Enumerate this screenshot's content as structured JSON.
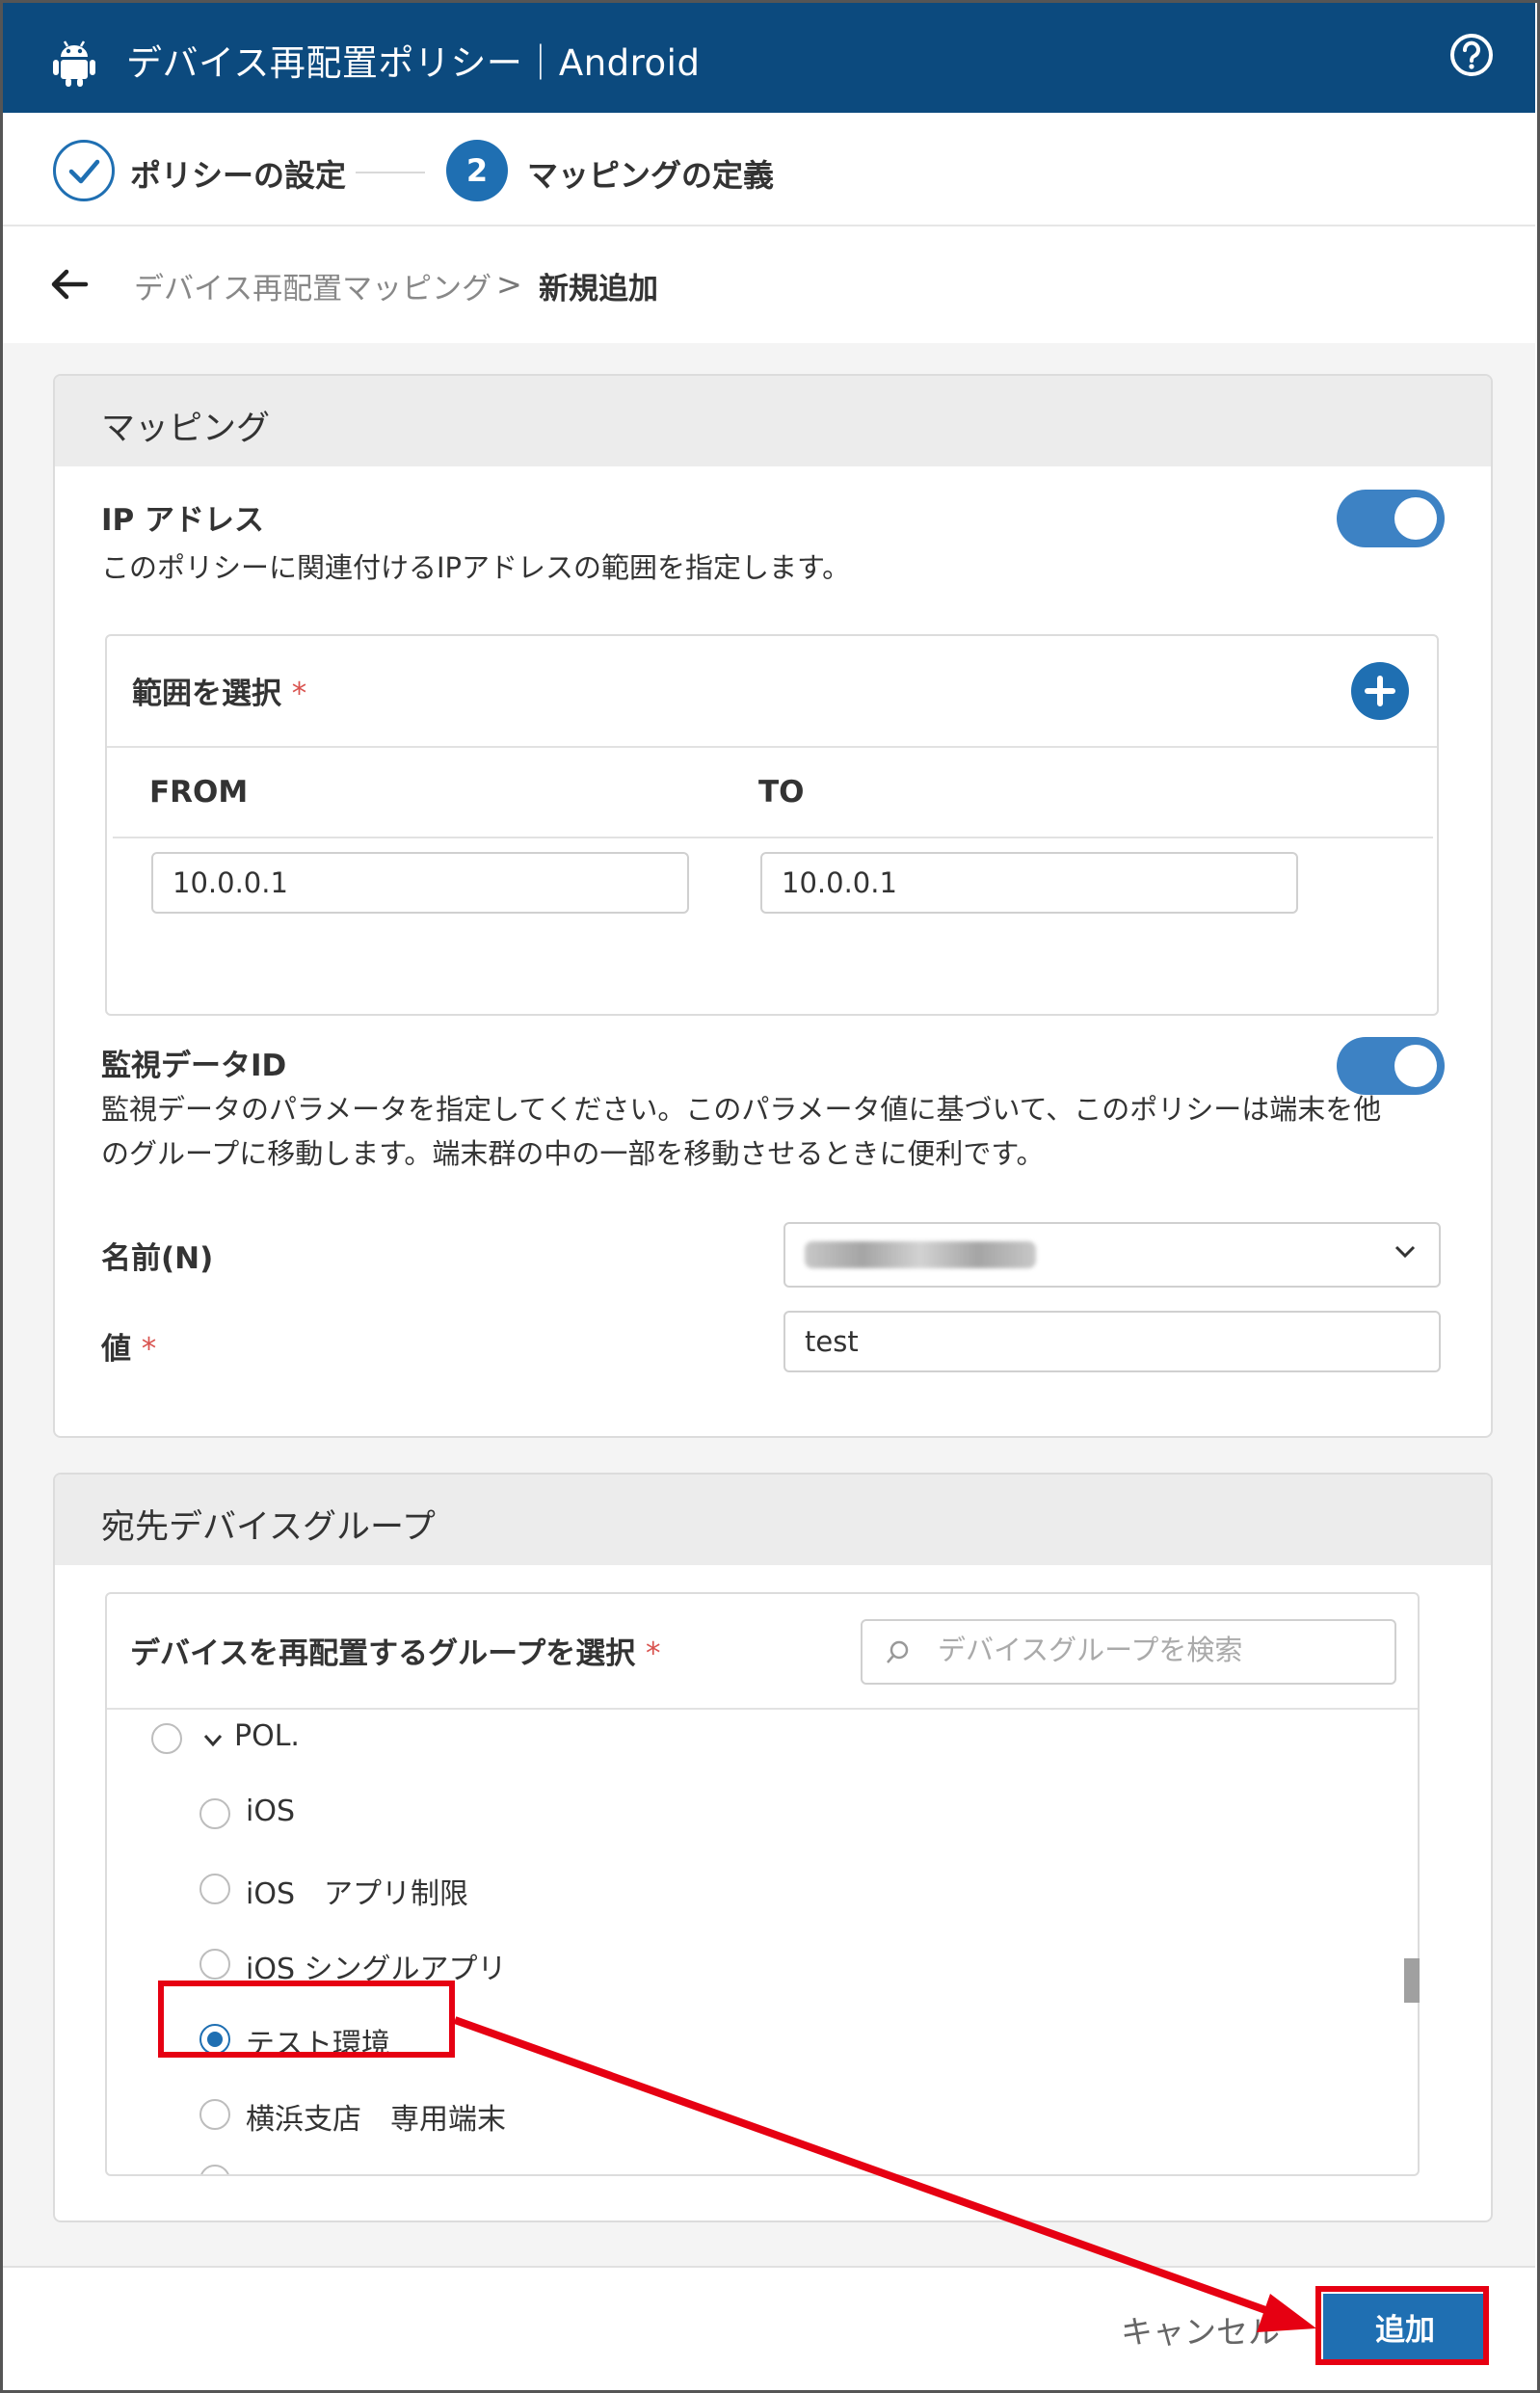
{
  "header": {
    "title": "デバイス再配置ポリシー｜Android",
    "logo_icon": "android-icon",
    "help_icon": "help-icon"
  },
  "stepper": {
    "steps": [
      {
        "label": "ポリシーの設定",
        "state": "done"
      },
      {
        "number": "2",
        "label": "マッピングの定義",
        "state": "active"
      }
    ]
  },
  "breadcrumb": {
    "parent": "デバイス再配置マッピング",
    "separator": ">",
    "current": "新規追加"
  },
  "mapping": {
    "title": "マッピング",
    "ip": {
      "label": "IP アドレス",
      "enabled": true,
      "description": "このポリシーに関連付けるIPアドレスの範囲を指定します。",
      "range_label": "範囲を選択",
      "required_mark": "*",
      "columns": [
        "FROM",
        "TO"
      ],
      "rows": [
        {
          "from": "10.0.0.1",
          "to": "10.0.0.1"
        }
      ]
    },
    "monitor": {
      "label": "監視データID",
      "enabled": true,
      "description_line1": "監視データのパラメータを指定してください。このパラメータ値に基づいて、このポリシーは端末を他",
      "description_line2": "のグループに移動します。端末群の中の一部を移動させるときに便利です。",
      "name_label": "名前(N)",
      "name_value": "",
      "value_label": "値",
      "value": "test"
    }
  },
  "destination": {
    "title": "宛先デバイスグループ",
    "select_label": "デバイスを再配置するグループを選択",
    "search_placeholder": "デバイスグループを検索",
    "tree": [
      {
        "label": "POL.",
        "selected": false
      },
      {
        "label": "iOS",
        "selected": false
      },
      {
        "label": "iOS　アプリ制限",
        "selected": false
      },
      {
        "label": "iOS シングルアプリ",
        "selected": false
      },
      {
        "label": "テスト環境",
        "selected": true
      },
      {
        "label": "横浜支店　専用端末",
        "selected": false
      }
    ]
  },
  "footer": {
    "cancel": "キャンセル",
    "add": "追加"
  },
  "colors": {
    "header_bg": "#0c4a7e",
    "accent": "#1f6fb2",
    "annotation": "#e60012"
  }
}
